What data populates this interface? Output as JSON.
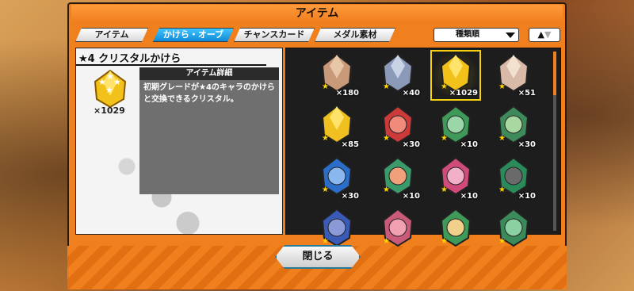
{
  "window": {
    "title": "アイテム"
  },
  "tabs": [
    {
      "label": "アイテム"
    },
    {
      "label": "かけら・オーブ"
    },
    {
      "label": "チャンスカード"
    },
    {
      "label": "メダル素材"
    }
  ],
  "sort": {
    "selected": "種類順",
    "toggle_up": "▲",
    "toggle_down": "▼"
  },
  "detail": {
    "item_name": "★4 クリスタルかけら",
    "count": "×1029",
    "detail_header": "アイテム詳細",
    "description": "初期グレードが★4のキャラのかけらと交換できるクリスタル。"
  },
  "items": [
    {
      "count": "×180",
      "kind": "crystal-bronze"
    },
    {
      "count": "×40",
      "kind": "crystal-silver"
    },
    {
      "count": "×1029",
      "kind": "crystal-gold"
    },
    {
      "count": "×51",
      "kind": "crystal-rainbow"
    },
    {
      "count": "×85",
      "kind": "crystal-sun"
    },
    {
      "count": "×30",
      "kind": "shard-luffy"
    },
    {
      "count": "×10",
      "kind": "shard-zoro"
    },
    {
      "count": "×30",
      "kind": "shard-usopp"
    },
    {
      "count": "×30",
      "kind": "shard-sanji"
    },
    {
      "count": "×10",
      "kind": "shard-nami"
    },
    {
      "count": "×10",
      "kind": "shard-chopper"
    },
    {
      "count": "×10",
      "kind": "shard-robin"
    },
    {
      "count": "",
      "kind": "shard-1"
    },
    {
      "count": "",
      "kind": "shard-2"
    },
    {
      "count": "",
      "kind": "shard-3"
    },
    {
      "count": "",
      "kind": "shard-4"
    }
  ],
  "close_button": {
    "label": "閉じる"
  },
  "colors": {
    "frame": "#f07f1e",
    "active_tab": "#1e9ee8",
    "selection": "#f5d112"
  }
}
